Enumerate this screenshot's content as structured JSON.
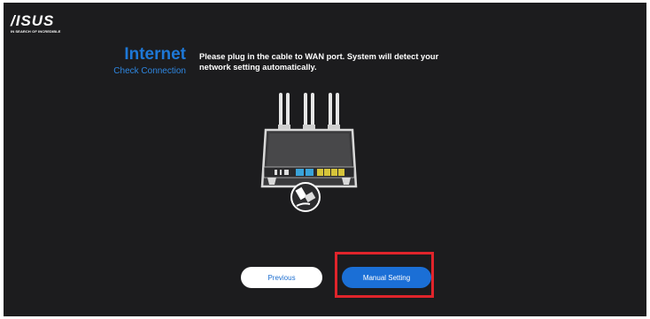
{
  "logo": {
    "word": "/ISUS",
    "tagline": "IN SEARCH OF INCREDIBLE"
  },
  "step": {
    "title": "Internet",
    "subtitle": "Check Connection"
  },
  "instruction": "Please plug in the cable to WAN port. System will detect your network setting automatically.",
  "buttons": {
    "previous": "Previous",
    "manual": "Manual Setting"
  },
  "colors": {
    "background": "#1c1c1e",
    "accent": "#1b6fd6",
    "highlight": "#e0242b",
    "wan_port": "#3aa3d9",
    "lan_port": "#d6c43a"
  },
  "icons": {
    "router": "router-illustration",
    "cable": "ethernet-cable-icon"
  }
}
